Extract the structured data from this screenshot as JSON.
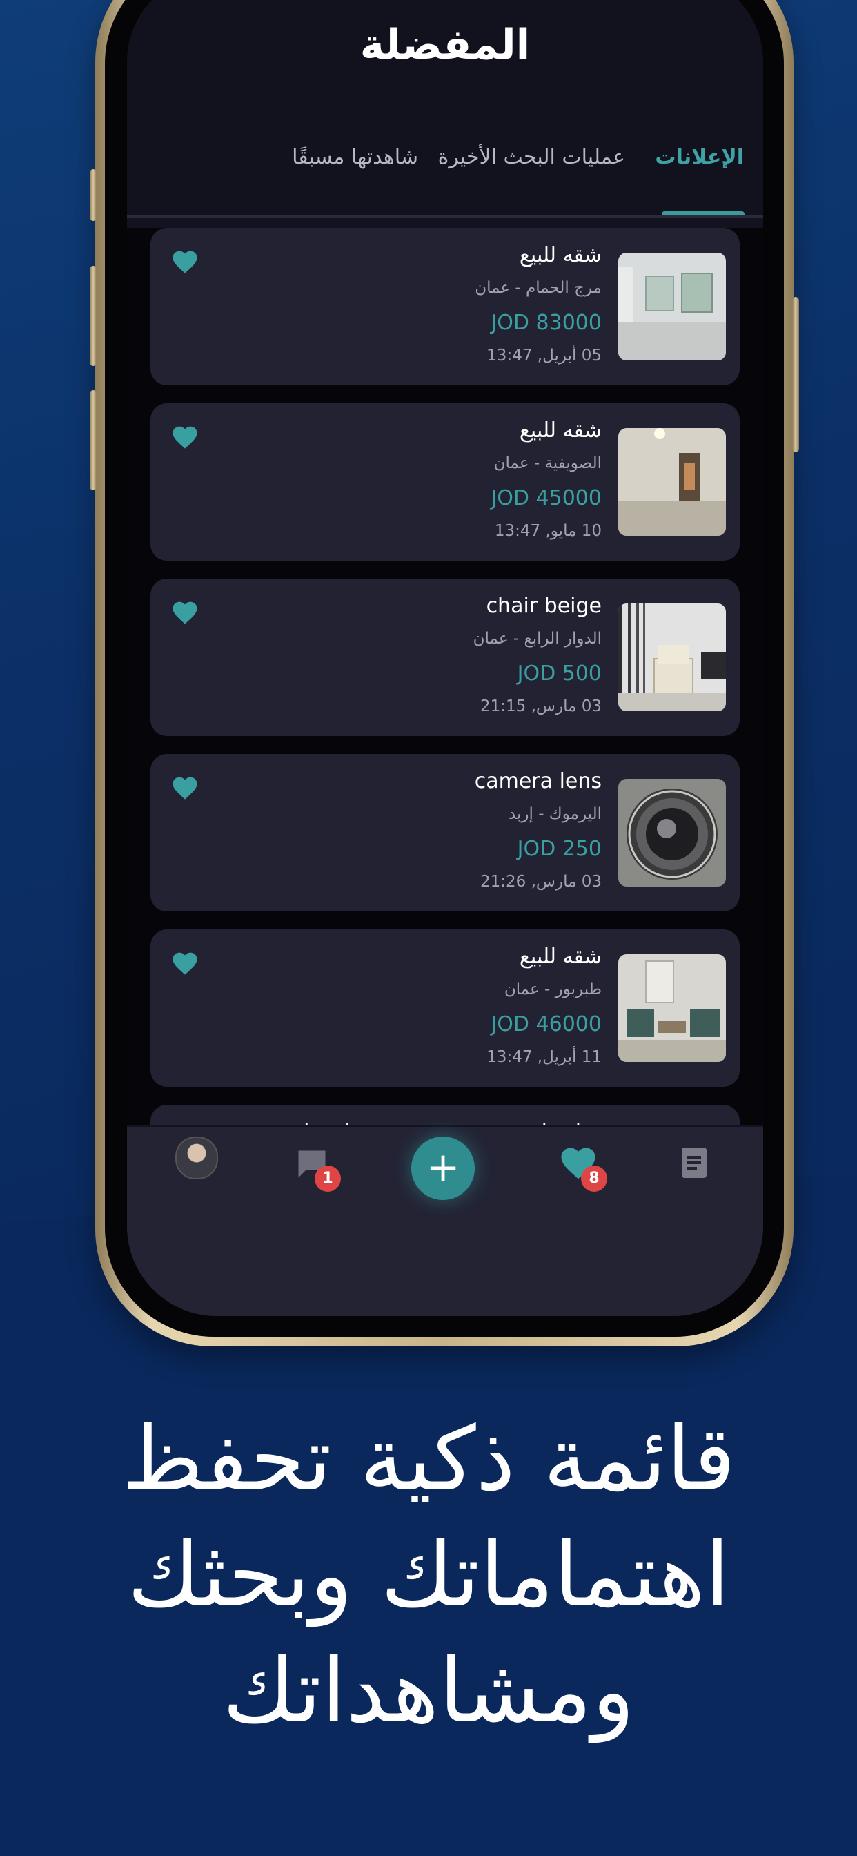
{
  "screen": {
    "title": "المفضلة",
    "tabs": [
      {
        "label": "الإعلانات",
        "active": true
      },
      {
        "label": "عمليات البحث الأخيرة",
        "active": false
      },
      {
        "label": "شاهدتها مسبقًا",
        "active": false
      }
    ]
  },
  "favorites": [
    {
      "title": "شقه للبيع",
      "location": "مرج الحمام - عمان",
      "price": "JOD 83000",
      "date": "05 أبريل, 13:47",
      "image": "empty-white-room"
    },
    {
      "title": "شقه للبيع",
      "location": "الصويفية - عمان",
      "price": "JOD 45000",
      "date": "10 مايو, 13:47",
      "image": "empty-room-door"
    },
    {
      "title": "chair beige",
      "location": "الدوار الرابع - عمان",
      "price": "JOD 500",
      "date": "03 مارس, 21:15",
      "image": "beige-chair"
    },
    {
      "title": "camera lens",
      "location": "اليرموك - إربد",
      "price": "JOD 250",
      "date": "03 مارس, 21:26",
      "image": "camera-lens"
    },
    {
      "title": "شقه للبيع",
      "location": "طبربور - عمان",
      "price": "JOD 46000",
      "date": "11 أبريل, 13:47",
      "image": "furnished-living-room"
    },
    {
      "title": "قطعة ارض شرق جرش - منطقة نادره _ حمامه",
      "location": "",
      "price": "",
      "date": "",
      "image": "land-landscape"
    }
  ],
  "bottom_nav": {
    "messages_badge": "1",
    "favorites_badge": "8",
    "add_symbol": "+",
    "icons": [
      "avatar",
      "chat-icon",
      "add-icon",
      "heart-icon",
      "document-icon"
    ]
  },
  "caption": {
    "line1": "قائمة ذكية تحفظ",
    "line2": "اهتماماتك وبحثك",
    "line3": "ومشاهداتك"
  },
  "colors": {
    "accent": "#3a9fa1",
    "background": "#0b2f66",
    "card": "#222232",
    "badge": "#e04545"
  }
}
